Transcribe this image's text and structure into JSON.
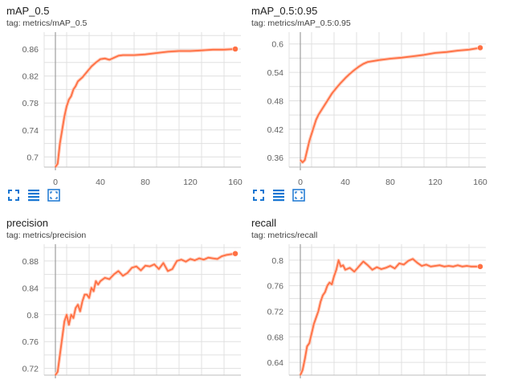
{
  "cards": [
    {
      "title": "mAP_0.5",
      "tag": "tag: metrics/mAP_0.5",
      "y_ticks": [
        "0.86",
        "0.82",
        "0.78",
        "0.74",
        "0.7"
      ],
      "x_ticks": [
        "0",
        "40",
        "80",
        "120",
        "160"
      ]
    },
    {
      "title": "mAP_0.5:0.95",
      "tag": "tag: metrics/mAP_0.5:0.95",
      "y_ticks": [
        "0.6",
        "0.54",
        "0.48",
        "0.42",
        "0.36"
      ],
      "x_ticks": [
        "0",
        "40",
        "80",
        "120",
        "160"
      ]
    },
    {
      "title": "precision",
      "tag": "tag: metrics/precision",
      "y_ticks": [
        "0.88",
        "0.84",
        "0.8",
        "0.76",
        "0.72"
      ],
      "x_ticks": []
    },
    {
      "title": "recall",
      "tag": "tag: metrics/recall",
      "y_ticks": [
        "0.8",
        "0.76",
        "0.72",
        "0.68",
        "0.64"
      ],
      "x_ticks": []
    }
  ],
  "colors": {
    "line": "#ff7043",
    "raw": "#ffccbc",
    "grid": "#e0e0e0",
    "icon": "#1976d2"
  },
  "toolbar_icons": [
    "fit-domain-icon",
    "toggle-log-scale-icon",
    "expand-chart-icon"
  ],
  "chart_data": [
    {
      "type": "line",
      "title": "mAP_0.5",
      "xlabel": "",
      "ylabel": "",
      "xlim": [
        -10,
        165
      ],
      "ylim": [
        0.685,
        0.885
      ],
      "grid": true,
      "x": [
        0,
        2,
        4,
        6,
        8,
        10,
        12,
        14,
        16,
        18,
        20,
        24,
        28,
        32,
        36,
        40,
        44,
        48,
        52,
        56,
        60,
        70,
        80,
        90,
        100,
        110,
        120,
        130,
        140,
        150,
        160
      ],
      "series": [
        {
          "values": [
            0.685,
            0.69,
            0.72,
            0.74,
            0.76,
            0.775,
            0.785,
            0.79,
            0.8,
            0.805,
            0.812,
            0.818,
            0.826,
            0.834,
            0.84,
            0.845,
            0.846,
            0.844,
            0.847,
            0.85,
            0.851,
            0.851,
            0.852,
            0.854,
            0.856,
            0.857,
            0.857,
            0.858,
            0.859,
            0.859,
            0.86
          ]
        }
      ]
    },
    {
      "type": "line",
      "title": "mAP_0.5:0.95",
      "xlabel": "",
      "ylabel": "",
      "xlim": [
        -10,
        165
      ],
      "ylim": [
        0.34,
        0.625
      ],
      "grid": true,
      "x": [
        0,
        2,
        4,
        6,
        8,
        10,
        12,
        14,
        16,
        20,
        24,
        28,
        32,
        36,
        40,
        44,
        48,
        52,
        56,
        60,
        70,
        80,
        90,
        100,
        110,
        120,
        130,
        140,
        150,
        160
      ],
      "series": [
        {
          "values": [
            0.355,
            0.35,
            0.355,
            0.375,
            0.395,
            0.41,
            0.425,
            0.44,
            0.45,
            0.465,
            0.48,
            0.495,
            0.507,
            0.518,
            0.528,
            0.537,
            0.545,
            0.552,
            0.558,
            0.562,
            0.566,
            0.569,
            0.571,
            0.574,
            0.577,
            0.581,
            0.583,
            0.586,
            0.588,
            0.592
          ]
        }
      ]
    },
    {
      "type": "line",
      "title": "precision",
      "xlabel": "",
      "ylabel": "",
      "xlim": [
        -10,
        165
      ],
      "ylim": [
        0.71,
        0.905
      ],
      "grid": true,
      "x": [
        0,
        2,
        4,
        6,
        8,
        10,
        12,
        14,
        16,
        18,
        20,
        22,
        24,
        26,
        28,
        30,
        32,
        34,
        36,
        38,
        40,
        44,
        48,
        52,
        56,
        60,
        64,
        68,
        72,
        76,
        80,
        84,
        88,
        92,
        96,
        100,
        104,
        108,
        112,
        116,
        120,
        124,
        128,
        132,
        136,
        140,
        144,
        148,
        152,
        156,
        160
      ],
      "series": [
        {
          "values": [
            0.71,
            0.715,
            0.74,
            0.765,
            0.79,
            0.8,
            0.785,
            0.8,
            0.795,
            0.81,
            0.815,
            0.805,
            0.82,
            0.83,
            0.83,
            0.825,
            0.84,
            0.835,
            0.85,
            0.845,
            0.85,
            0.855,
            0.853,
            0.86,
            0.865,
            0.858,
            0.862,
            0.87,
            0.872,
            0.866,
            0.873,
            0.872,
            0.875,
            0.868,
            0.877,
            0.865,
            0.868,
            0.88,
            0.882,
            0.879,
            0.883,
            0.881,
            0.884,
            0.882,
            0.885,
            0.884,
            0.883,
            0.887,
            0.889,
            0.89,
            0.891
          ]
        }
      ]
    },
    {
      "type": "line",
      "title": "recall",
      "xlabel": "",
      "ylabel": "",
      "xlim": [
        -10,
        165
      ],
      "ylim": [
        0.62,
        0.825
      ],
      "grid": true,
      "x": [
        0,
        2,
        4,
        6,
        8,
        10,
        12,
        14,
        16,
        18,
        20,
        22,
        24,
        26,
        28,
        30,
        32,
        34,
        36,
        38,
        40,
        44,
        48,
        52,
        56,
        60,
        64,
        68,
        72,
        76,
        80,
        84,
        88,
        92,
        96,
        100,
        104,
        108,
        112,
        116,
        120,
        124,
        128,
        132,
        136,
        140,
        144,
        148,
        152,
        156,
        160
      ],
      "series": [
        {
          "values": [
            0.62,
            0.628,
            0.645,
            0.665,
            0.67,
            0.685,
            0.7,
            0.71,
            0.72,
            0.735,
            0.745,
            0.75,
            0.76,
            0.765,
            0.762,
            0.775,
            0.785,
            0.8,
            0.79,
            0.792,
            0.785,
            0.788,
            0.782,
            0.79,
            0.798,
            0.792,
            0.785,
            0.789,
            0.786,
            0.788,
            0.791,
            0.787,
            0.795,
            0.793,
            0.799,
            0.802,
            0.796,
            0.791,
            0.793,
            0.79,
            0.791,
            0.792,
            0.79,
            0.791,
            0.79,
            0.792,
            0.79,
            0.791,
            0.79,
            0.79,
            0.79
          ]
        }
      ]
    }
  ]
}
